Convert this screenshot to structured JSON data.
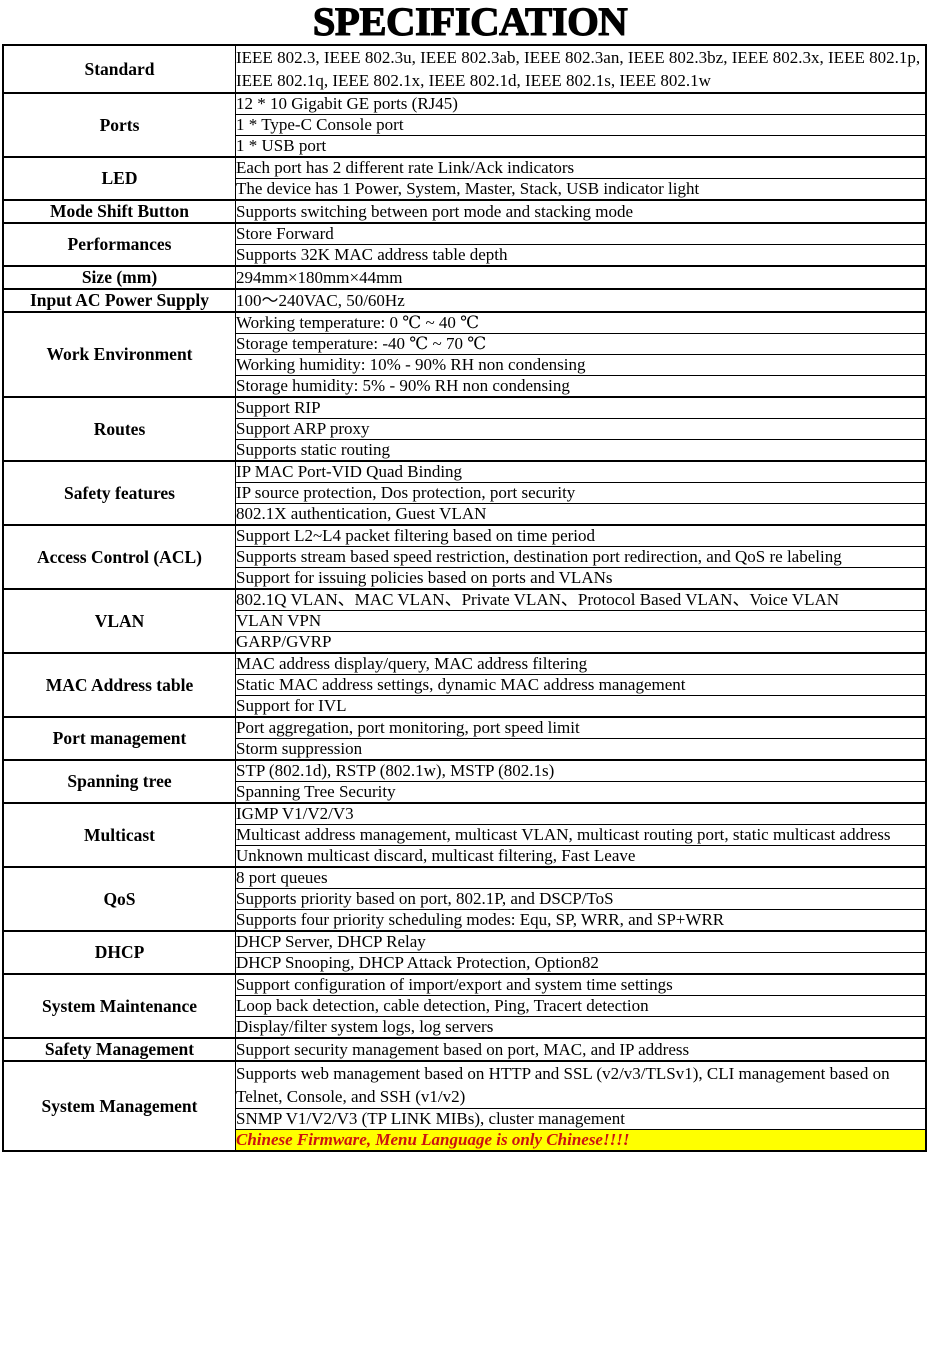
{
  "title": "SPECIFICATION",
  "colors": {
    "warning_background": "#FFFF00",
    "warning_text": "#CC1111",
    "border": "#000000",
    "page_background": "#FFFFFF"
  },
  "table": {
    "rows": [
      {
        "label": "Standard",
        "values": [
          "IEEE 802.3, IEEE 802.3u, IEEE 802.3ab, IEEE 802.3an, IEEE 802.3bz, IEEE 802.3x, IEEE 802.1p, IEEE 802.1q, IEEE 802.1x, IEEE 802.1d, IEEE 802.1s, IEEE 802.1w"
        ]
      },
      {
        "label": "Ports",
        "values": [
          "12 * 10 Gigabit GE ports (RJ45)",
          "1 * Type-C Console port",
          "1 * USB port"
        ]
      },
      {
        "label": "LED",
        "values": [
          "Each port has 2 different rate Link/Ack indicators",
          "The device has 1 Power, System, Master, Stack, USB indicator light"
        ]
      },
      {
        "label": "Mode Shift Button",
        "values": [
          "Supports switching between port mode and stacking mode"
        ]
      },
      {
        "label": "Performances",
        "values": [
          "Store Forward",
          "Supports 32K MAC address table depth"
        ]
      },
      {
        "label": "Size (mm)",
        "values": [
          "294mm×180mm×44mm"
        ]
      },
      {
        "label": "Input AC Power Supply",
        "values": [
          "100〜240VAC, 50/60Hz"
        ]
      },
      {
        "label": "Work Environment",
        "values": [
          "Working temperature: 0 ℃ ~ 40 ℃",
          "Storage temperature: -40 ℃ ~ 70 ℃",
          "Working humidity: 10% - 90% RH non condensing",
          "Storage humidity: 5% - 90% RH non condensing"
        ]
      },
      {
        "label": "Routes",
        "values": [
          "Support RIP",
          "Support ARP proxy",
          "Supports static routing"
        ]
      },
      {
        "label": "Safety features",
        "values": [
          "IP MAC Port-VID Quad Binding",
          "IP source protection, Dos protection, port security",
          "802.1X authentication, Guest VLAN"
        ]
      },
      {
        "label": "Access Control (ACL)",
        "values": [
          "Support L2~L4 packet filtering based on time period",
          "Supports stream based speed restriction, destination port redirection, and QoS re labeling",
          "Support for issuing policies based on ports and VLANs"
        ]
      },
      {
        "label": "VLAN",
        "values": [
          "802.1Q VLAN、MAC VLAN、Private VLAN、Protocol Based VLAN、Voice VLAN",
          "VLAN VPN",
          "GARP/GVRP"
        ]
      },
      {
        "label": "MAC Address table",
        "values": [
          "MAC address display/query, MAC address filtering",
          "Static MAC address settings, dynamic MAC address management",
          "Support for IVL"
        ]
      },
      {
        "label": "Port management",
        "values": [
          "Port aggregation, port monitoring, port speed limit",
          "Storm suppression"
        ]
      },
      {
        "label": "Spanning tree",
        "values": [
          "STP (802.1d), RSTP (802.1w), MSTP (802.1s)",
          "Spanning Tree Security"
        ]
      },
      {
        "label": "Multicast",
        "values": [
          "IGMP V1/V2/V3",
          "Multicast address management, multicast VLAN, multicast routing port, static multicast address",
          "Unknown multicast discard, multicast filtering, Fast Leave"
        ]
      },
      {
        "label": "QoS",
        "values": [
          "8 port queues",
          "Supports priority based on port, 802.1P, and DSCP/ToS",
          "Supports four priority scheduling modes: Equ, SP, WRR, and SP+WRR"
        ]
      },
      {
        "label": "DHCP",
        "values": [
          "DHCP Server, DHCP Relay",
          "DHCP Snooping, DHCP Attack Protection, Option82"
        ]
      },
      {
        "label": "System Maintenance",
        "values": [
          "Support configuration of import/export and system time settings",
          "Loop back detection, cable detection, Ping, Tracert detection",
          "Display/filter system logs, log servers"
        ]
      },
      {
        "label": "Safety Management",
        "values": [
          "Support security management based on port, MAC, and IP address"
        ]
      },
      {
        "label": "System Management",
        "values": [
          "Supports web management based on HTTP and SSL (v2/v3/TLSv1), CLI management based on Telnet, Console, and SSH (v1/v2)",
          "SNMP V1/V2/V3 (TP LINK MIBs), cluster management",
          "Chinese Firmware, Menu Language is only Chinese!!!!"
        ],
        "warning_index": 2
      }
    ]
  }
}
